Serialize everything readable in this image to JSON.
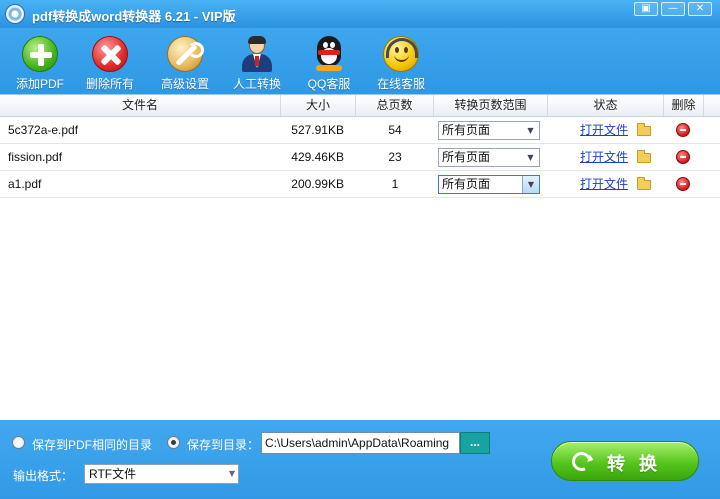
{
  "window": {
    "title": "pdf转换成word转换器 6.21 - VIP版",
    "restore_glyph": "▣",
    "minimize_glyph": "—",
    "close_glyph": "✕"
  },
  "toolbar": {
    "items": [
      {
        "label": "添加PDF",
        "icon": "add-icon"
      },
      {
        "label": "删除所有",
        "icon": "delete-all-icon"
      },
      {
        "label": "高级设置",
        "icon": "wrench-icon"
      },
      {
        "label": "人工转换",
        "icon": "agent-icon"
      },
      {
        "label": "QQ客服",
        "icon": "qq-penguin-icon"
      },
      {
        "label": "在线客服",
        "icon": "headset-smiley-icon"
      }
    ]
  },
  "table": {
    "columns": [
      "文件名",
      "大小",
      "总页数",
      "转换页数范围",
      "状态",
      "删除"
    ],
    "rows": [
      {
        "name": "5c372a-e.pdf",
        "size": "527.91KB",
        "pages": "54",
        "range": "所有页面",
        "status": "打开文件"
      },
      {
        "name": "fission.pdf",
        "size": "429.46KB",
        "pages": "23",
        "range": "所有页面",
        "status": "打开文件"
      },
      {
        "name": "a1.pdf",
        "size": "200.99KB",
        "pages": "1",
        "range": "所有页面",
        "status": "打开文件"
      }
    ]
  },
  "output": {
    "same_dir_label": "保存到PDF相同的目录",
    "save_to_label": "保存到目录：",
    "selected_option": "save_to",
    "path": "C:\\Users\\admin\\AppData\\Roaming",
    "browse_label": "...",
    "format_label": "输出格式：",
    "format_value": "RTF文件",
    "convert_label": "转换"
  },
  "colors": {
    "accent": "#3aa0e8",
    "convert_button": "#56c61e",
    "link": "#1a3fc8"
  }
}
